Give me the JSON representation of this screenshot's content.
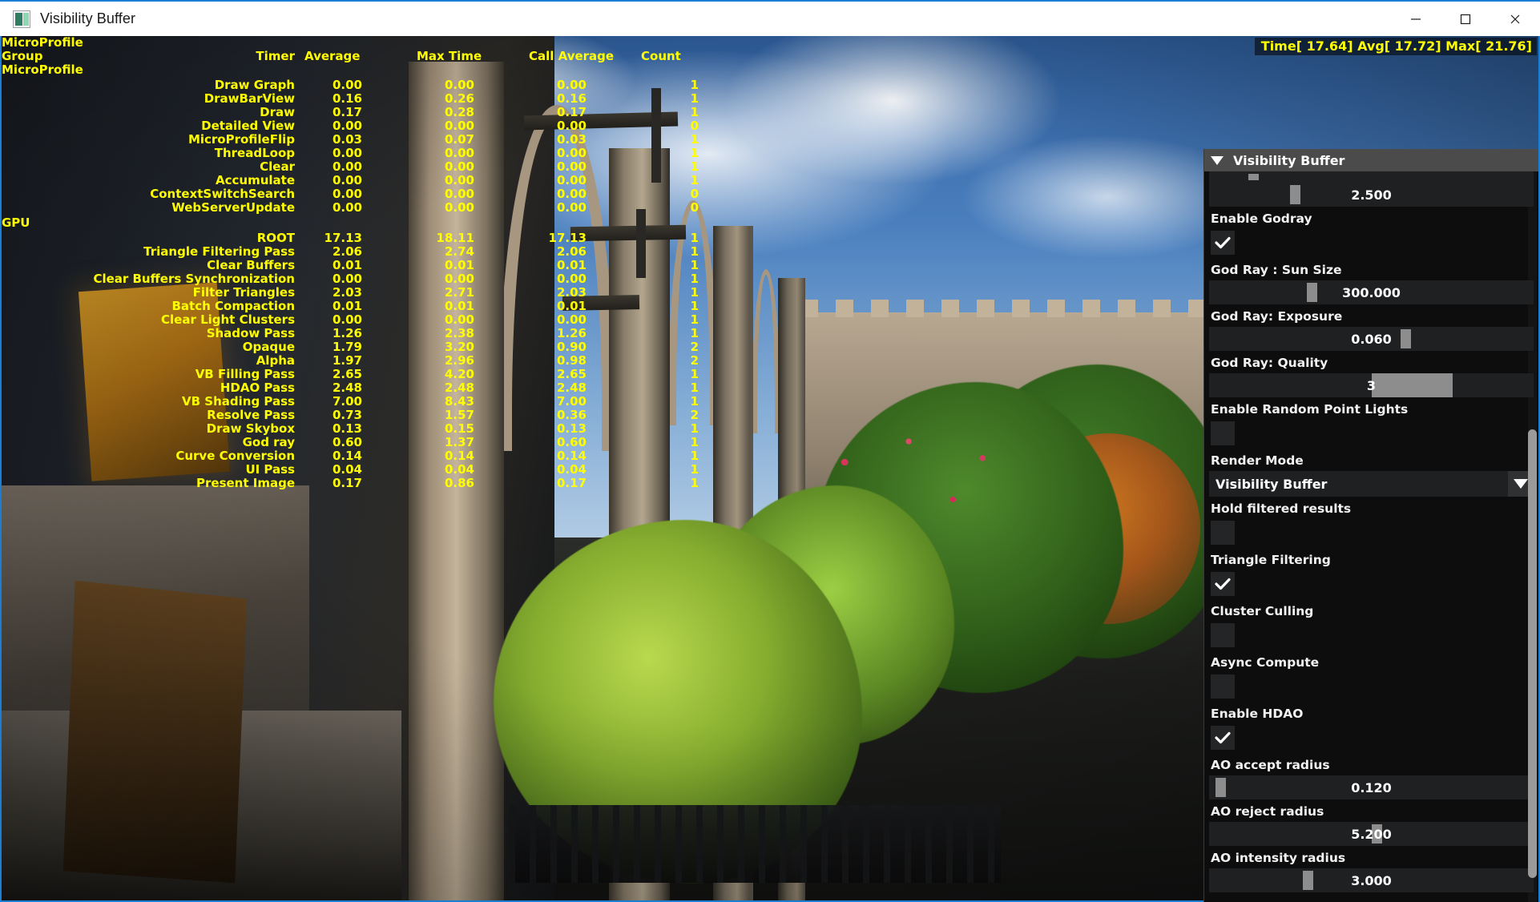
{
  "window": {
    "title": "Visibility Buffer",
    "icon": "app-icon",
    "controls": {
      "minimize": "minimize-icon",
      "maximize": "maximize-icon",
      "close": "close-icon"
    }
  },
  "timing": {
    "text": "Time[ 17.64] Avg[ 17.72] Max[ 21.76]"
  },
  "profiler": {
    "title": "MicroProfile",
    "headers": {
      "group": "Group",
      "timer": "Timer",
      "average": "Average",
      "max_time": "Max Time",
      "call_average": "Call Average",
      "count": "Count"
    },
    "groups": [
      {
        "name": "MicroProfile",
        "rows": [
          {
            "timer": "Draw Graph",
            "average": "0.00",
            "max": "0.00",
            "call_average": "0.00",
            "count": "1"
          },
          {
            "timer": "DrawBarView",
            "average": "0.16",
            "max": "0.26",
            "call_average": "0.16",
            "count": "1"
          },
          {
            "timer": "Draw",
            "average": "0.17",
            "max": "0.28",
            "call_average": "0.17",
            "count": "1"
          },
          {
            "timer": "Detailed View",
            "average": "0.00",
            "max": "0.00",
            "call_average": "0.00",
            "count": "0"
          },
          {
            "timer": "MicroProfileFlip",
            "average": "0.03",
            "max": "0.07",
            "call_average": "0.03",
            "count": "1"
          },
          {
            "timer": "ThreadLoop",
            "average": "0.00",
            "max": "0.00",
            "call_average": "0.00",
            "count": "1"
          },
          {
            "timer": "Clear",
            "average": "0.00",
            "max": "0.00",
            "call_average": "0.00",
            "count": "1"
          },
          {
            "timer": "Accumulate",
            "average": "0.00",
            "max": "0.00",
            "call_average": "0.00",
            "count": "1"
          },
          {
            "timer": "ContextSwitchSearch",
            "average": "0.00",
            "max": "0.00",
            "call_average": "0.00",
            "count": "0"
          },
          {
            "timer": "WebServerUpdate",
            "average": "0.00",
            "max": "0.00",
            "call_average": "0.00",
            "count": "0"
          }
        ]
      },
      {
        "name": "GPU",
        "rows": [
          {
            "timer": "ROOT",
            "average": "17.13",
            "max": "18.11",
            "call_average": "17.13",
            "count": "1"
          },
          {
            "timer": "Triangle Filtering Pass",
            "average": "2.06",
            "max": "2.74",
            "call_average": "2.06",
            "count": "1"
          },
          {
            "timer": "Clear Buffers",
            "average": "0.01",
            "max": "0.01",
            "call_average": "0.01",
            "count": "1"
          },
          {
            "timer": "Clear Buffers Synchronization",
            "average": "0.00",
            "max": "0.00",
            "call_average": "0.00",
            "count": "1"
          },
          {
            "timer": "Filter Triangles",
            "average": "2.03",
            "max": "2.71",
            "call_average": "2.03",
            "count": "1"
          },
          {
            "timer": "Batch Compaction",
            "average": "0.01",
            "max": "0.01",
            "call_average": "0.01",
            "count": "1"
          },
          {
            "timer": "Clear Light Clusters",
            "average": "0.00",
            "max": "0.00",
            "call_average": "0.00",
            "count": "1"
          },
          {
            "timer": "Shadow Pass",
            "average": "1.26",
            "max": "2.38",
            "call_average": "1.26",
            "count": "1"
          },
          {
            "timer": "Opaque",
            "average": "1.79",
            "max": "3.20",
            "call_average": "0.90",
            "count": "2"
          },
          {
            "timer": "Alpha",
            "average": "1.97",
            "max": "2.96",
            "call_average": "0.98",
            "count": "2"
          },
          {
            "timer": "VB Filling Pass",
            "average": "2.65",
            "max": "4.20",
            "call_average": "2.65",
            "count": "1"
          },
          {
            "timer": "HDAO Pass",
            "average": "2.48",
            "max": "2.48",
            "call_average": "2.48",
            "count": "1"
          },
          {
            "timer": "VB Shading Pass",
            "average": "7.00",
            "max": "8.43",
            "call_average": "7.00",
            "count": "1"
          },
          {
            "timer": "Resolve Pass",
            "average": "0.73",
            "max": "1.57",
            "call_average": "0.36",
            "count": "2"
          },
          {
            "timer": "Draw Skybox",
            "average": "0.13",
            "max": "0.15",
            "call_average": "0.13",
            "count": "1"
          },
          {
            "timer": "God ray",
            "average": "0.60",
            "max": "1.37",
            "call_average": "0.60",
            "count": "1"
          },
          {
            "timer": "Curve Conversion",
            "average": "0.14",
            "max": "0.14",
            "call_average": "0.14",
            "count": "1"
          },
          {
            "timer": "UI Pass",
            "average": "0.04",
            "max": "0.04",
            "call_average": "0.04",
            "count": "1"
          },
          {
            "timer": "Present Image",
            "average": "0.17",
            "max": "0.86",
            "call_average": "0.17",
            "count": "1"
          }
        ]
      }
    ]
  },
  "panel": {
    "title": "Visibility Buffer",
    "collapse_icon": "caret-down-icon",
    "controls": [
      {
        "kind": "slider",
        "name": "clipped-slider-top",
        "label": null,
        "value": "",
        "thumb_pct": 12,
        "clipped": true
      },
      {
        "kind": "slider",
        "name": "sun-ray-density",
        "label": null,
        "value": "2.500",
        "thumb_pct": 25
      },
      {
        "kind": "checkbox",
        "name": "enable-godray",
        "label": "Enable Godray",
        "checked": true
      },
      {
        "kind": "slider",
        "name": "god-ray-sun-size",
        "label": "God Ray : Sun Size",
        "value": "300.000",
        "thumb_pct": 30
      },
      {
        "kind": "slider",
        "name": "god-ray-exposure",
        "label": "God Ray: Exposure",
        "value": "0.060",
        "thumb_pct": 59
      },
      {
        "kind": "fillslider",
        "name": "god-ray-quality",
        "label": "God Ray: Quality",
        "value": "3",
        "fill_start_pct": 50,
        "fill_end_pct": 75
      },
      {
        "kind": "checkbox",
        "name": "enable-random-point-lights",
        "label": "Enable Random Point Lights",
        "checked": false
      },
      {
        "kind": "dropdown",
        "name": "render-mode",
        "label": "Render Mode",
        "value": "Visibility Buffer"
      },
      {
        "kind": "checkbox",
        "name": "hold-filtered-results",
        "label": "Hold filtered results",
        "checked": false
      },
      {
        "kind": "checkbox",
        "name": "triangle-filtering",
        "label": "Triangle Filtering",
        "checked": true
      },
      {
        "kind": "checkbox",
        "name": "cluster-culling",
        "label": "Cluster Culling",
        "checked": false
      },
      {
        "kind": "checkbox",
        "name": "async-compute",
        "label": "Async Compute",
        "checked": false
      },
      {
        "kind": "checkbox",
        "name": "enable-hdao",
        "label": "Enable HDAO",
        "checked": true
      },
      {
        "kind": "slider",
        "name": "ao-accept-radius",
        "label": "AO accept radius",
        "value": "0.120",
        "thumb_pct": 2
      },
      {
        "kind": "slider",
        "name": "ao-reject-radius",
        "label": "AO reject radius",
        "value": "5.200",
        "thumb_pct": 50
      },
      {
        "kind": "slider",
        "name": "ao-intensity-radius",
        "label": "AO intensity radius",
        "value": "3.000",
        "thumb_pct": 29
      }
    ]
  },
  "colors": {
    "accent_border": "#1a7fd4",
    "profiler_text": "#ffff00",
    "panel_bg": "#0d0d0d",
    "panel_header": "#4b4b4b",
    "slider_track": "#1e2022",
    "slider_thumb": "#8d8d8d"
  }
}
